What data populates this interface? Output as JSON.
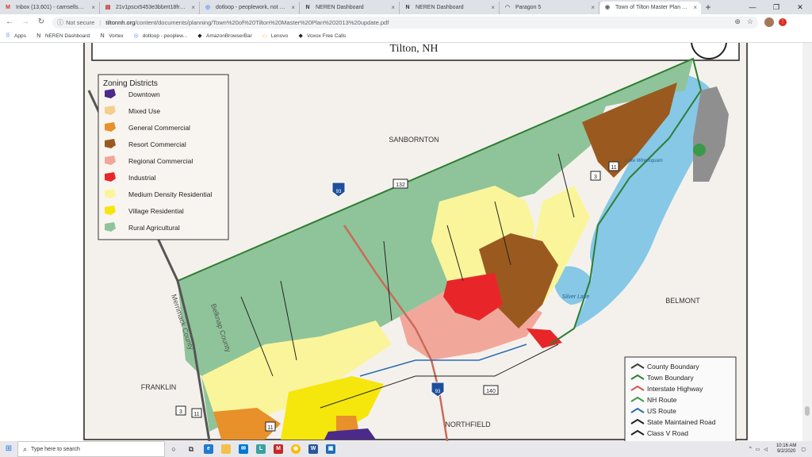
{
  "browser": {
    "tabs": [
      {
        "label": "Inbox (13,601) - camsellsnh@gm",
        "icon": "gmail-icon",
        "icon_text": "M",
        "icon_color": "#d93025"
      },
      {
        "label": "21v1pscx5453e3bbmt18fr6ue1v",
        "icon": "document-icon",
        "icon_text": "▤",
        "icon_color": "#c5221f"
      },
      {
        "label": "dotloop - peoplework, not pape",
        "icon": "dotloop-icon",
        "icon_text": "◎",
        "icon_color": "#5a8dee"
      },
      {
        "label": "NEREN Dashboard",
        "icon": "neren-icon",
        "icon_text": "N",
        "icon_color": "#333333"
      },
      {
        "label": "NEREN Dashboard",
        "icon": "neren-icon",
        "icon_text": "N",
        "icon_color": "#333333"
      },
      {
        "label": "Paragon 5",
        "icon": "paragon-icon",
        "icon_text": "◠",
        "icon_color": "#666666"
      },
      {
        "label": "Town of Tilton Master Plan 2013",
        "icon": "globe-icon",
        "icon_text": "◉",
        "icon_color": "#5f6368",
        "active": true
      }
    ],
    "new_tab": "+",
    "window_controls": {
      "minimize": "—",
      "restore": "❐",
      "close": "✕"
    },
    "address": {
      "not_secure": "Not secure",
      "host": "tiltonnh.org",
      "path": "/content/documents/planning/Town%20of%20Tilton%20Master%20Plan%202013%20update.pdf"
    },
    "bookmarks": [
      {
        "label": "Apps",
        "icon": "apps-icon",
        "icon_text": "⠿",
        "icon_color": "#1a73e8"
      },
      {
        "label": "NEREN Dashboard",
        "icon": "neren-icon",
        "icon_text": "N",
        "icon_color": "#333333"
      },
      {
        "label": "Vortex",
        "icon": "vortex-icon",
        "icon_text": "N",
        "icon_color": "#333333"
      },
      {
        "label": "dotloop - peoplew...",
        "icon": "dotloop-icon",
        "icon_text": "◎",
        "icon_color": "#5a8dee"
      },
      {
        "label": "AmazonBrowserBar",
        "icon": "amazon-icon",
        "icon_text": "◆",
        "icon_color": "#222222"
      },
      {
        "label": "Lenovo",
        "icon": "folder-icon",
        "icon_text": "▭",
        "icon_color": "#f2c94c"
      },
      {
        "label": "Voxox Free Calls",
        "icon": "voxox-icon",
        "icon_text": "◆",
        "icon_color": "#222222"
      }
    ]
  },
  "map": {
    "heading": "Tilton, NH",
    "legend_title": "Zoning Districts",
    "zoning": [
      {
        "label": "Downtown",
        "color": "#4b2a8a"
      },
      {
        "label": "Mixed Use",
        "color": "#f6cf8e"
      },
      {
        "label": "General Commercial",
        "color": "#e8902a"
      },
      {
        "label": "Resort Commercial",
        "color": "#9a5a1f"
      },
      {
        "label": "Regional Commercial",
        "color": "#f2a79b"
      },
      {
        "label": "Industrial",
        "color": "#e8262a"
      },
      {
        "label": "Medium Density Residential",
        "color": "#faf59a"
      },
      {
        "label": "Village Residential",
        "color": "#f5e60c"
      },
      {
        "label": "Rural Agricultural",
        "color": "#8fc49a"
      }
    ],
    "lines_legend": [
      {
        "label": "County Boundary",
        "color": "#3a3a3a"
      },
      {
        "label": "Town Boundary",
        "color": "#2e7d32"
      },
      {
        "label": "Interstate Highway",
        "color": "#d9534f"
      },
      {
        "label": "NH Route",
        "color": "#3a9a4a"
      },
      {
        "label": "US Route",
        "color": "#2b6cb0"
      },
      {
        "label": "State Maintained Road",
        "color": "#222222"
      },
      {
        "label": "Class V Road",
        "color": "#222222"
      }
    ],
    "place_labels": {
      "sanbornton": "SANBORNTON",
      "belmont": "BELMONT",
      "franklin": "FRANKLIN",
      "northfield": "NORTHFIELD",
      "lake_winnisquam": "Lake Winnisquam",
      "silver_lake": "Silver Lake",
      "belknap": "Belknap County",
      "merrimack": "Merrimack County"
    },
    "shields": {
      "i93_a": "93",
      "i93_b": "93",
      "nh132": "132",
      "nh140": "140",
      "us3_a": "3",
      "us3_b": "3",
      "nh11_a": "11",
      "nh11_b": "11",
      "nh11_c": "11"
    }
  },
  "taskbar": {
    "search_placeholder": "Type here to search",
    "time": "10:16 AM",
    "date": "9/2/2020"
  }
}
